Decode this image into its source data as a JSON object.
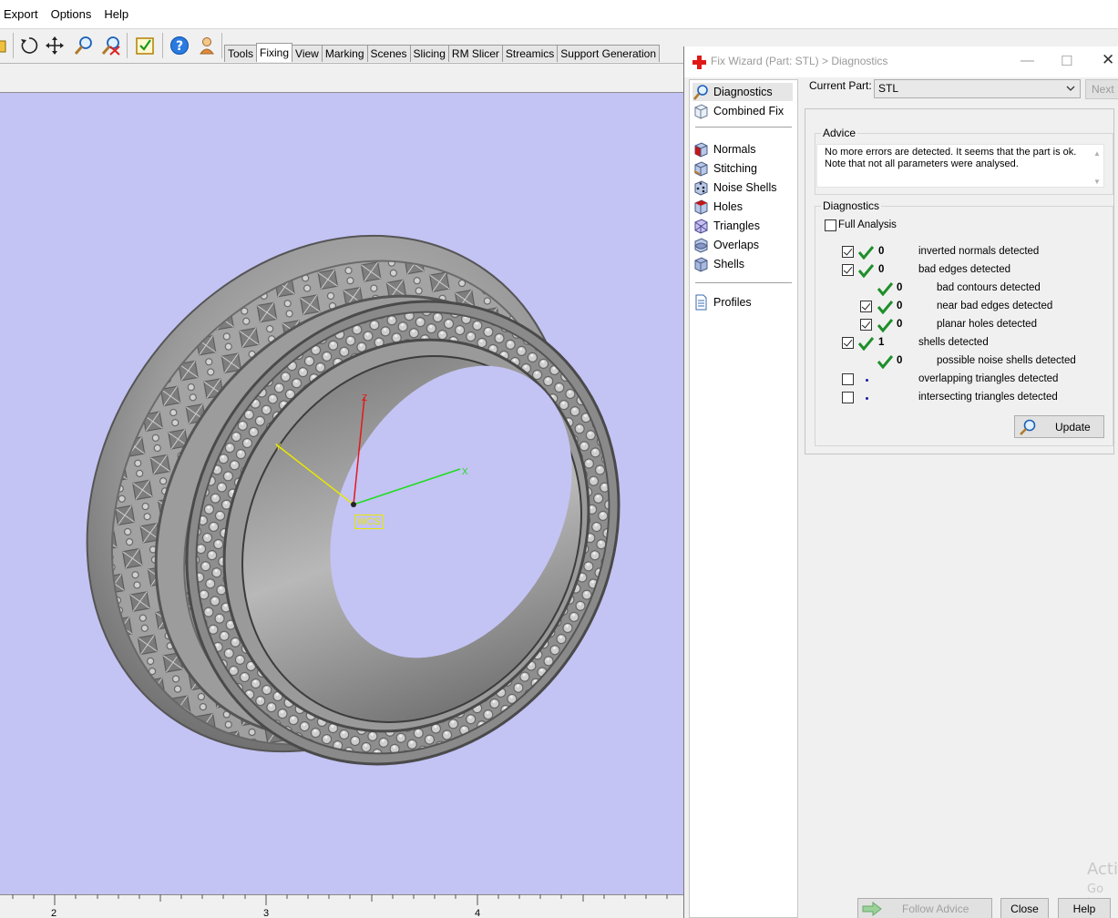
{
  "menu": {
    "items": [
      "Export",
      "Options",
      "Help"
    ]
  },
  "toolbar": {
    "icons": [
      "rotate-icon",
      "pan-icon",
      "zoom-icon",
      "zoom-cancel-icon",
      "checklist-icon",
      "help-icon",
      "figure-icon"
    ],
    "tabs": [
      "Tools",
      "Fixing",
      "View",
      "Marking",
      "Scenes",
      "Slicing",
      "RM Slicer",
      "Streamics",
      "Support Generation"
    ],
    "active_tab": "Fixing"
  },
  "viewport": {
    "background": "#c3c3f4",
    "wcs_label": "WCS",
    "axes": {
      "x": "X",
      "y": "Y",
      "z": "Z"
    },
    "axis_colors": {
      "x": "#1fdc1f",
      "y": "#e8e800",
      "z": "#e31919"
    },
    "ruler_labels": [
      "2",
      "3",
      "4"
    ]
  },
  "dialog": {
    "title": "Fix Wizard (Part: STL) > Diagnostics",
    "nav": {
      "items": [
        {
          "label": "Diagnostics",
          "icon": "magnifier-icon",
          "selected": true
        },
        {
          "label": "Combined Fix",
          "icon": "cube-icon"
        },
        {
          "label": "Normals",
          "icon": "normals-cube-icon"
        },
        {
          "label": "Stitching",
          "icon": "stitching-cube-icon"
        },
        {
          "label": "Noise Shells",
          "icon": "noise-cube-icon"
        },
        {
          "label": "Holes",
          "icon": "holes-cube-icon"
        },
        {
          "label": "Triangles",
          "icon": "triangles-cube-icon"
        },
        {
          "label": "Overlaps",
          "icon": "overlaps-cube-icon"
        },
        {
          "label": "Shells",
          "icon": "shells-cube-icon"
        },
        {
          "label": "Profiles",
          "icon": "document-icon"
        }
      ]
    },
    "current_part_label": "Current Part:",
    "current_part_value": "STL",
    "next_label": "Next",
    "advice": {
      "title": "Advice",
      "line1": "No more errors are detected. It seems that the part is ok.",
      "line2": "Note that not all parameters were analysed."
    },
    "diagnostics": {
      "title": "Diagnostics",
      "full_analysis_label": "Full Analysis",
      "rows": [
        {
          "label": "inverted normals detected",
          "count": "0",
          "checked": true,
          "status": "ok",
          "indent": 0
        },
        {
          "label": "bad edges detected",
          "count": "0",
          "checked": true,
          "status": "ok",
          "indent": 0
        },
        {
          "label": "bad contours detected",
          "count": "0",
          "checked": null,
          "status": "ok",
          "indent": 1
        },
        {
          "label": "near bad edges detected",
          "count": "0",
          "checked": true,
          "status": "ok",
          "indent": 1
        },
        {
          "label": "planar holes detected",
          "count": "0",
          "checked": true,
          "status": "ok",
          "indent": 1
        },
        {
          "label": "shells detected",
          "count": "1",
          "checked": true,
          "status": "ok",
          "indent": 0
        },
        {
          "label": "possible noise shells detected",
          "count": "0",
          "checked": null,
          "status": "ok",
          "indent": 1
        },
        {
          "label": "overlapping triangles detected",
          "count": "",
          "checked": false,
          "status": "pending",
          "indent": 0
        },
        {
          "label": "intersecting triangles detected",
          "count": "",
          "checked": false,
          "status": "pending",
          "indent": 0
        }
      ],
      "update_label": "Update"
    },
    "buttons": {
      "follow_advice": "Follow Advice",
      "close": "Close",
      "help": "Help"
    },
    "watermark": {
      "line1": "Acti",
      "line2": "Go to"
    }
  }
}
